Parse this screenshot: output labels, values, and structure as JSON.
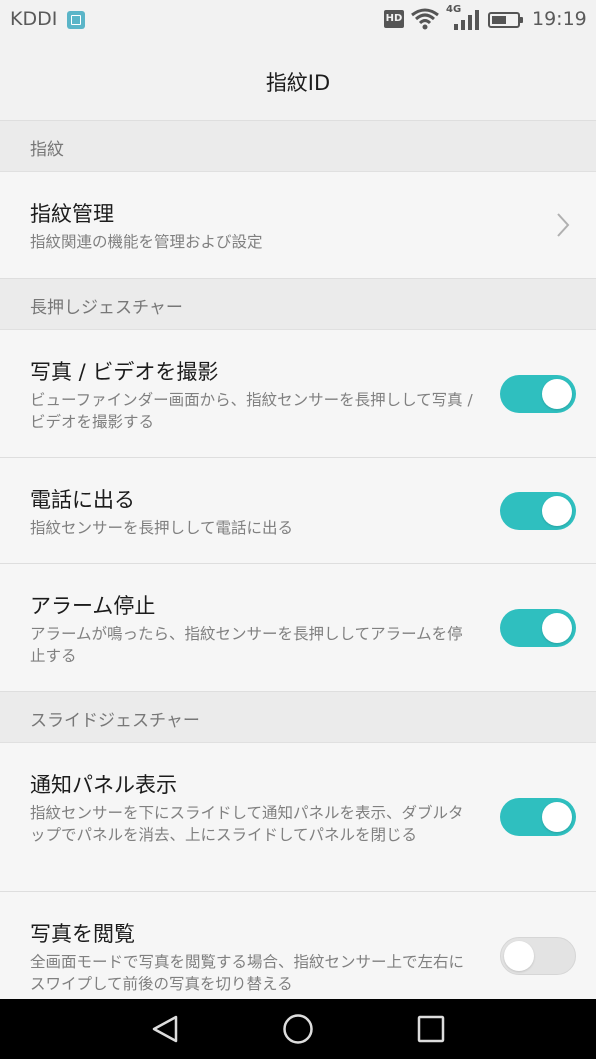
{
  "status_bar": {
    "carrier": "KDDI",
    "network_type": "4G",
    "time": "19:19",
    "icons": [
      "gallery-icon",
      "hd-icon",
      "wifi-icon",
      "cellular-signal-icon",
      "battery-icon"
    ],
    "hd_label": "HD"
  },
  "header": {
    "title": "指紋ID"
  },
  "sections": {
    "fingerprint": {
      "header": "指紋",
      "manage": {
        "title": "指紋管理",
        "desc": "指紋関連の機能を管理および設定"
      }
    },
    "long_press": {
      "header": "長押しジェスチャー",
      "photo": {
        "title": "写真 / ビデオを撮影",
        "desc": "ビューファインダー画面から、指紋センサーを長押しして写真 / ビデオを撮影する",
        "enabled": true
      },
      "call": {
        "title": "電話に出る",
        "desc": "指紋センサーを長押しして電話に出る",
        "enabled": true
      },
      "alarm": {
        "title": "アラーム停止",
        "desc": "アラームが鳴ったら、指紋センサーを長押ししてアラームを停止する",
        "enabled": true
      }
    },
    "slide": {
      "header": "スライドジェスチャー",
      "notification": {
        "title": "通知パネル表示",
        "desc": "指紋センサーを下にスライドして通知パネルを表示、ダブルタップでパネルを消去、上にスライドしてパネルを閉じる",
        "enabled": true
      },
      "browse": {
        "title": "写真を閲覧",
        "desc": "全画面モードで写真を閲覧する場合、指紋センサー上で左右にスワイプして前後の写真を切り替える",
        "enabled": false
      }
    }
  },
  "nav_bar": {
    "icons": [
      "back-icon",
      "home-icon",
      "recents-icon"
    ]
  },
  "colors": {
    "accent": "#2fbfbf",
    "background": "#f6f6f6",
    "section_bg": "#ebebeb",
    "nav_bar": "#000000"
  }
}
